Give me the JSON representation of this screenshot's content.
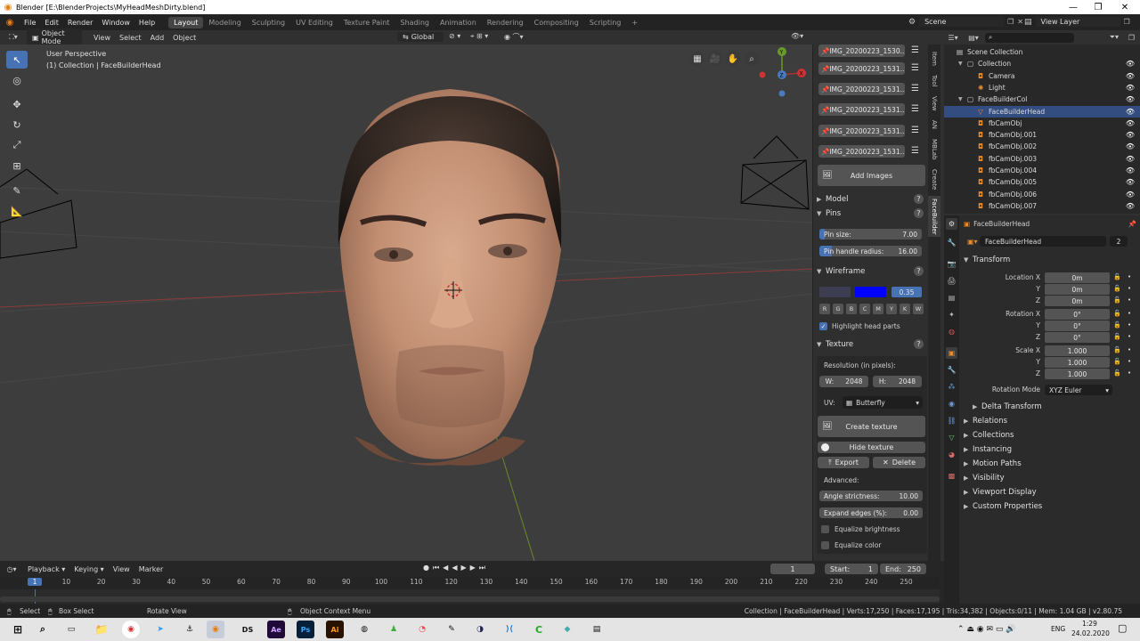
{
  "window": {
    "title": "Blender [E:\\BlenderProjects\\MyHeadMeshDirty.blend]"
  },
  "topmenu": {
    "items": [
      "File",
      "Edit",
      "Render",
      "Window",
      "Help"
    ],
    "workspaces": [
      "Layout",
      "Modeling",
      "Sculpting",
      "UV Editing",
      "Texture Paint",
      "Shading",
      "Animation",
      "Rendering",
      "Compositing",
      "Scripting"
    ],
    "plus": "+",
    "scene_label": "Scene",
    "view_layer_label": "View Layer"
  },
  "viewport_header": {
    "mode": "Object Mode",
    "menus": [
      "View",
      "Select",
      "Add",
      "Object"
    ],
    "orientation": "Global"
  },
  "viewport": {
    "perspective": "User Perspective",
    "collection_info": "(1) Collection | FaceBuilderHead",
    "gizmo": {
      "x": "X",
      "y": "Y",
      "z": "Z"
    }
  },
  "npanel": {
    "images": [
      "IMG_20200223_1530...",
      "IMG_20200223_1531...",
      "IMG_20200223_1531...",
      "IMG_20200223_1531...",
      "IMG_20200223_1531...",
      "IMG_20200223_1531..."
    ],
    "add_images": "Add Images",
    "model_label": "Model",
    "pins_label": "Pins",
    "pin_size_label": "Pin size:",
    "pin_size_value": "7.00",
    "pin_size_fraction": 0.05,
    "pin_radius_label": "Pin handle radius:",
    "pin_radius_value": "16.00",
    "pin_radius_fraction": 0.12,
    "wireframe_label": "Wireframe",
    "wire_color": "#3d3d52",
    "wire_special_color": "#0000ff",
    "wire_opacity": "0.35",
    "wire_letters": [
      "R",
      "G",
      "B",
      "C",
      "M",
      "Y",
      "K",
      "W"
    ],
    "highlight_label": "Highlight head parts",
    "texture_label": "Texture",
    "resolution_label": "Resolution (in pixels):",
    "res_w_label": "W:",
    "res_w": "2048",
    "res_h_label": "H:",
    "res_h": "2048",
    "uv_label": "UV:",
    "uv_value": "Butterfly",
    "create_texture": "Create texture",
    "hide_texture": "Hide texture",
    "export": "Export",
    "delete": "Delete",
    "advanced_label": "Advanced:",
    "angle_label": "Angle strictness:",
    "angle_value": "10.00",
    "expand_label": "Expand edges (%):",
    "expand_value": "0.00",
    "equalize_brightness": "Equalize brightness",
    "equalize_color": "Equalize color"
  },
  "vtabs": [
    "Item",
    "Tool",
    "View",
    "AN",
    "MBLab",
    "Create",
    "FaceBuilder"
  ],
  "outliner": {
    "rows": [
      {
        "name": "Scene Collection",
        "indent": 0
      },
      {
        "name": "Collection",
        "indent": 1
      },
      {
        "name": "Camera",
        "indent": 2
      },
      {
        "name": "Light",
        "indent": 2
      },
      {
        "name": "FaceBuilderCol",
        "indent": 1
      },
      {
        "name": "FaceBuilderHead",
        "indent": 2
      },
      {
        "name": "fbCamObj",
        "indent": 2
      },
      {
        "name": "fbCamObj.001",
        "indent": 2
      },
      {
        "name": "fbCamObj.002",
        "indent": 2
      },
      {
        "name": "fbCamObj.003",
        "indent": 2
      },
      {
        "name": "fbCamObj.004",
        "indent": 2
      },
      {
        "name": "fbCamObj.005",
        "indent": 2
      },
      {
        "name": "fbCamObj.006",
        "indent": 2
      },
      {
        "name": "fbCamObj.007",
        "indent": 2
      }
    ]
  },
  "properties": {
    "header_object": "FaceBuilderHead",
    "object_name": "FaceBuilderHead",
    "users": "2",
    "transform_label": "Transform",
    "location_x_label": "Location X",
    "location": [
      "0m",
      "0m",
      "0m"
    ],
    "rotation_x_label": "Rotation X",
    "rotation": [
      "0°",
      "0°",
      "0°"
    ],
    "scale_x_label": "Scale X",
    "scale": [
      "1.000",
      "1.000",
      "1.000"
    ],
    "y_label": "Y",
    "z_label": "Z",
    "rotation_mode_label": "Rotation Mode",
    "rotation_mode": "XYZ Euler",
    "delta_transform": "Delta Transform",
    "sections": [
      "Relations",
      "Collections",
      "Instancing",
      "Motion Paths",
      "Visibility",
      "Viewport Display",
      "Custom Properties"
    ]
  },
  "timeline": {
    "menus": [
      "Playback",
      "Keying",
      "View",
      "Marker"
    ],
    "current_frame": "1",
    "start_label": "Start:",
    "start": "1",
    "end_label": "End:",
    "end": "250",
    "ticks": [
      "1",
      "10",
      "20",
      "30",
      "40",
      "50",
      "60",
      "70",
      "80",
      "90",
      "100",
      "110",
      "120",
      "130",
      "140",
      "150",
      "160",
      "170",
      "180",
      "190",
      "200",
      "210",
      "220",
      "230",
      "240",
      "250"
    ]
  },
  "status": {
    "select": "Select",
    "box_select": "Box Select",
    "rotate_view": "Rotate View",
    "context_menu": "Object Context Menu",
    "stats": "Collection | FaceBuilderHead | Verts:17,250 | Faces:17,195 | Tris:34,382 | Objects:0/11 | Mem: 1.04 GB | v2.80.75"
  },
  "taskbar": {
    "lang": "ENG",
    "time": "1:29",
    "date": "24.02.2020"
  }
}
